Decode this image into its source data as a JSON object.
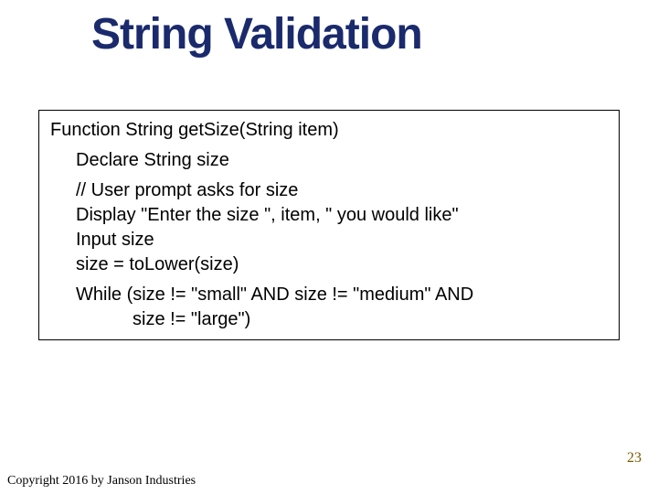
{
  "title": "String Validation",
  "code": {
    "l1": "Function String getSize(String item)",
    "l2": "Declare String size",
    "l3": "// User prompt asks for size",
    "l4": "Display \"Enter the size \", item, \" you would like\"",
    "l5": "Input size",
    "l6": "size = toLower(size)",
    "l7": "While (size != \"small\" AND size != \"medium\" AND",
    "l8": "size != \"large\")"
  },
  "pagenum": "23",
  "copyright": "Copyright 2016 by Janson Industries"
}
